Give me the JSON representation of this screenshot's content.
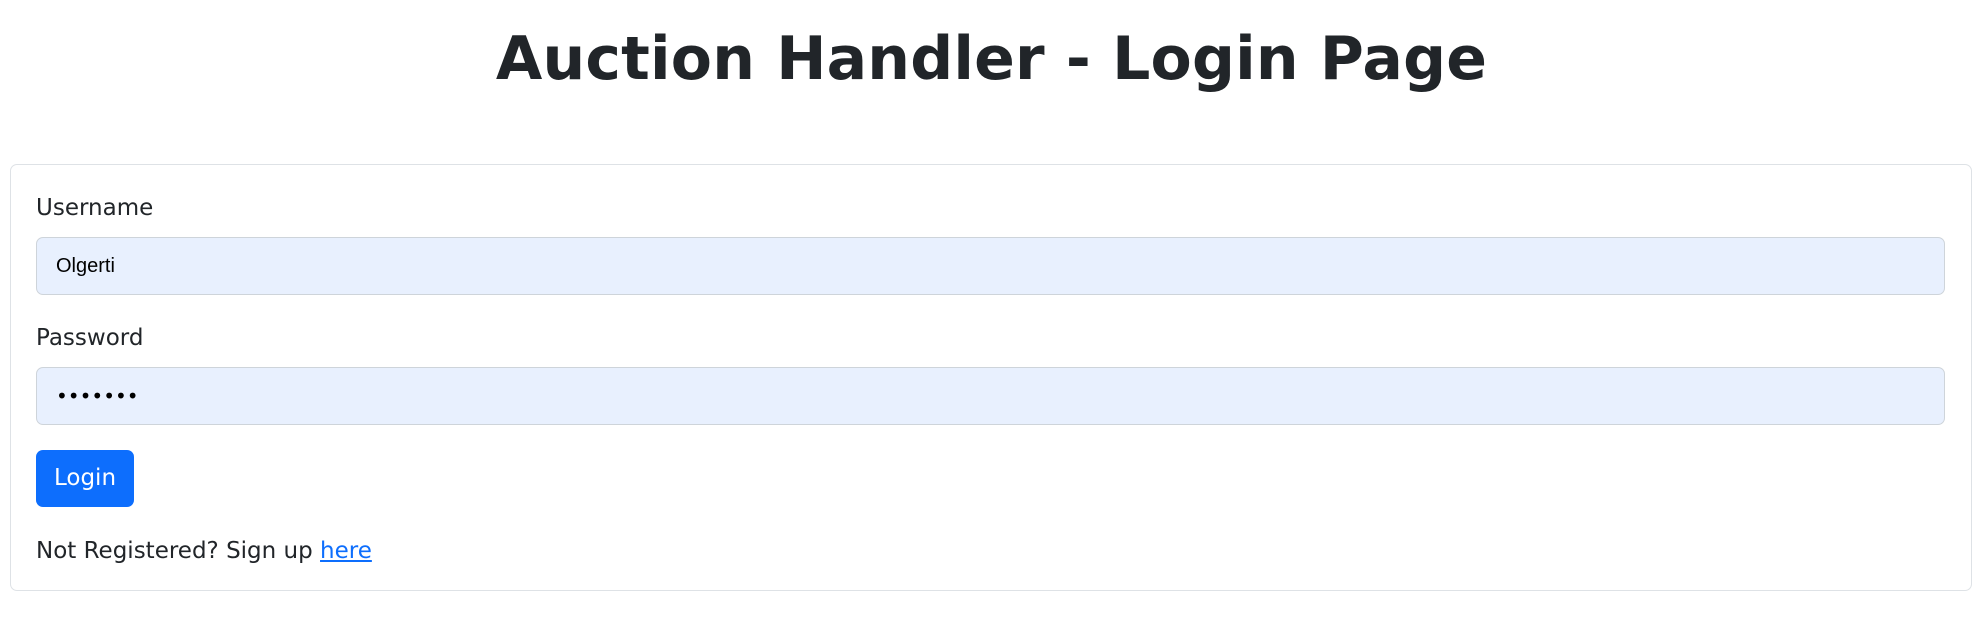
{
  "header": {
    "title": "Auction Handler - Login Page"
  },
  "form": {
    "username": {
      "label": "Username",
      "value": "Olgerti"
    },
    "password": {
      "label": "Password",
      "value": "•••••••"
    },
    "login_button_label": "Login",
    "signup": {
      "prompt": "Not Registered? Sign up ",
      "link_text": "here"
    }
  },
  "colors": {
    "primary": "#0d6efd",
    "input_autofill_bg": "#e8f0fe",
    "text": "#212529",
    "card_border": "#dee2e6"
  }
}
